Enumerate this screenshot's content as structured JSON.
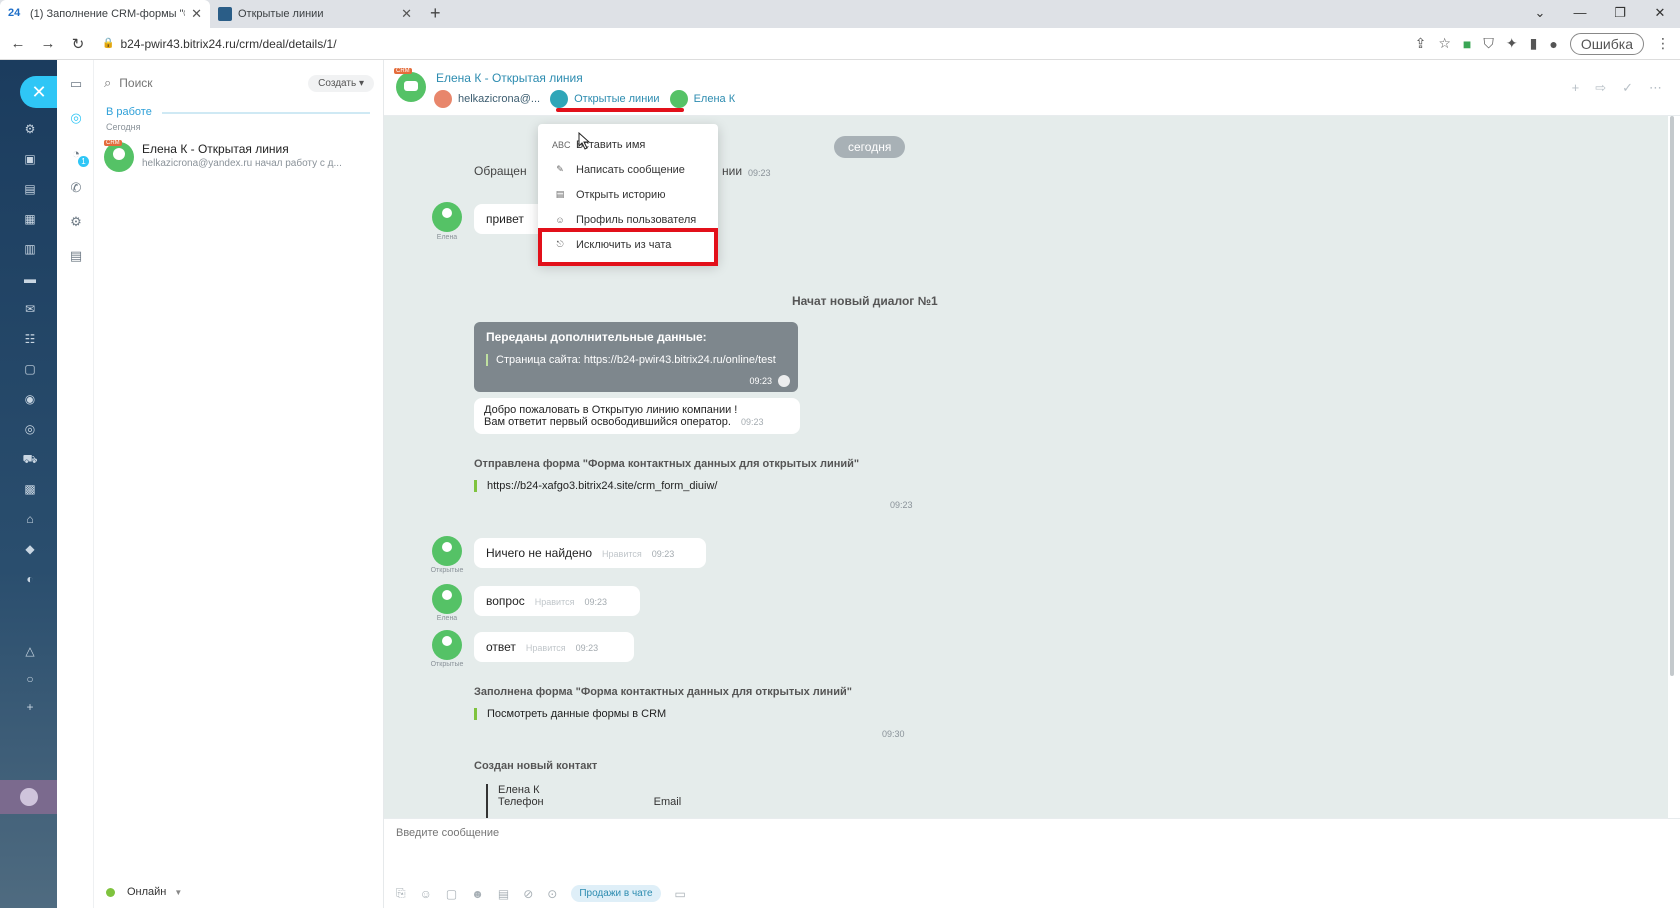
{
  "browser": {
    "tabs": [
      {
        "icon": "24",
        "label": "(1) Заполнение CRM-формы \"©",
        "close": "✕"
      },
      {
        "label": "Открытые линии",
        "close": "✕"
      }
    ],
    "new_tab": "+",
    "window_controls": [
      "⌄",
      "—",
      "❐",
      "✕"
    ],
    "url": "b24-pwir43.bitrix24.ru/crm/deal/details/1/",
    "error_button": "Ошибка"
  },
  "chat_list": {
    "search_placeholder": "Поиск",
    "create_button": "Создать",
    "section_title": "В работе",
    "section_sub": "Сегодня",
    "items": [
      {
        "title": "Елена К - Открытая линия",
        "preview": "helkazicrona@yandex.ru начал работу с д...",
        "badge": "CRM"
      }
    ],
    "status": "Онлайн"
  },
  "chat_header": {
    "badge": "CRM",
    "title": "Елена К - Открытая линия",
    "members": [
      "helkazicrona@...",
      "Открытые линии",
      "Елена К"
    ]
  },
  "context_menu": {
    "items": [
      {
        "icon": "ABC",
        "label": "Вставить имя"
      },
      {
        "icon": "✎",
        "label": "Написать сообщение"
      },
      {
        "icon": "▤",
        "label": "Открыть историю"
      },
      {
        "icon": "☺",
        "label": "Профиль пользователя"
      },
      {
        "icon": "⎋",
        "label": "Исключить из чата"
      }
    ]
  },
  "chat": {
    "date_pill": "сегодня",
    "obrash_text": "Обращен",
    "obrash_tail": "нии",
    "obrash_time": "09:23",
    "msg1": {
      "author": "Елена",
      "text": "привет"
    },
    "new_dialog": "Начат новый диалог №1",
    "extra_data": {
      "title": "Переданы дополнительные данные:",
      "line": "Страница сайта: https://b24-pwir43.bitrix24.ru/online/test",
      "time": "09:23"
    },
    "welcome": {
      "line1": "Добро пожаловать в Открытую линию компании !",
      "line2": "Вам ответит первый освободившийся оператор.",
      "time": "09:23"
    },
    "form_sent": {
      "title": "Отправлена форма \"Форма контактных данных для открытых линий\"",
      "link": "https://b24-xafgo3.bitrix24.site/crm_form_diuiw/",
      "time": "09:23"
    },
    "msg2": {
      "author": "Открытые",
      "text": "Ничего не найдено",
      "like": "Нравится",
      "time": "09:23"
    },
    "msg3": {
      "author": "Елена",
      "text": "вопрос",
      "like": "Нравится",
      "time": "09:23"
    },
    "msg4": {
      "author": "Открытые",
      "text": "ответ",
      "like": "Нравится",
      "time": "09:23"
    },
    "form_filled": {
      "title": "Заполнена форма \"Форма контактных данных для открытых линий\"",
      "link": "Посмотреть данные формы в CRM",
      "time": "09:30"
    },
    "new_contact": {
      "title": "Создан новый контакт",
      "name": "Елена К",
      "phone_label": "Телефон",
      "email_label": "Email"
    }
  },
  "composer": {
    "placeholder": "Введите сообщение",
    "sales_button": "Продажи в чате"
  },
  "colors": {
    "accent": "#2fc6f6",
    "annotation_red": "#e2101a",
    "online_green": "#7fc33e"
  }
}
